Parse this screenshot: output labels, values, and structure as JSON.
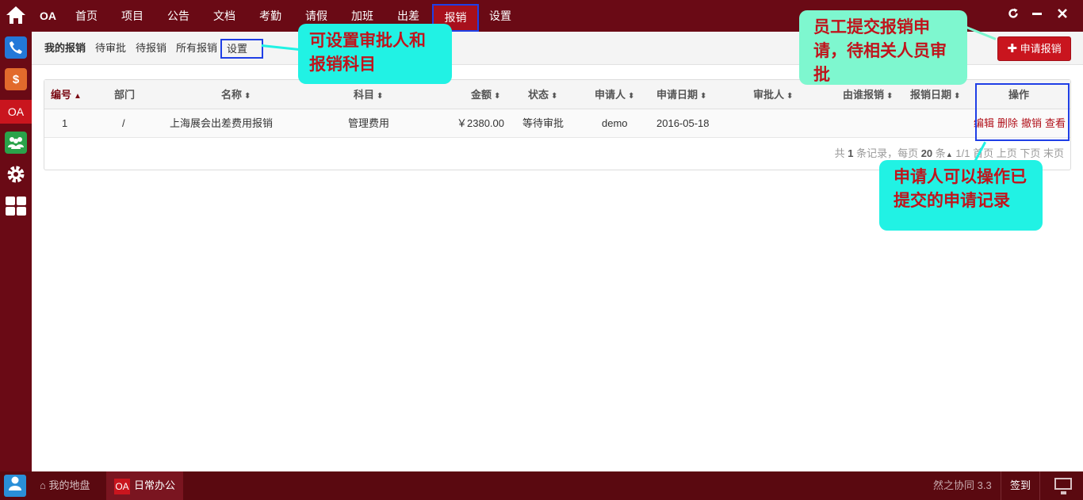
{
  "topnav": {
    "brand": "OA",
    "items": [
      "首页",
      "项目",
      "公告",
      "文档",
      "考勤",
      "请假",
      "加班",
      "出差",
      "报销",
      "设置"
    ],
    "active": "报销"
  },
  "subnav": {
    "items": [
      "我的报销",
      "待审批",
      "待报销",
      "所有报销",
      "设置"
    ],
    "apply_button": "申请报销"
  },
  "table": {
    "headers": [
      "编号",
      "部门",
      "名称",
      "科目",
      "金额",
      "状态",
      "申请人",
      "申请日期",
      "审批人",
      "由谁报销",
      "报销日期",
      "操作"
    ],
    "rows": [
      {
        "id": "1",
        "dept": "/",
        "name": "上海展会出差费用报销",
        "subject": "管理费用",
        "amount": "￥2380.00",
        "status": "等待审批",
        "applicant": "demo",
        "apply_date": "2016-05-18",
        "approver": "",
        "reimburser": "",
        "reimburse_date": ""
      }
    ],
    "ops": [
      "编辑",
      "删除",
      "撤销",
      "查看"
    ]
  },
  "pager": {
    "total_prefix": "共",
    "total_count": "1",
    "total_suffix": "条记录，每页",
    "page_size": "20",
    "page_size_suffix": "条",
    "page_info": "1/1",
    "first": "首页",
    "prev": "上页",
    "next": "下页",
    "last": "末页"
  },
  "callouts": {
    "settings": "可设置审批人和报销科目",
    "apply": "员工提交报销申请，待相关人员审批",
    "ops": "申请人可以操作已提交的申请记录"
  },
  "taskbar": {
    "my_disk": "我的地盘",
    "daily_office": "日常办公",
    "oa_badge": "OA",
    "version": "然之协同 3.3",
    "sign_in": "签到"
  },
  "dock": {
    "oa_label": "OA",
    "money_symbol": "$"
  }
}
